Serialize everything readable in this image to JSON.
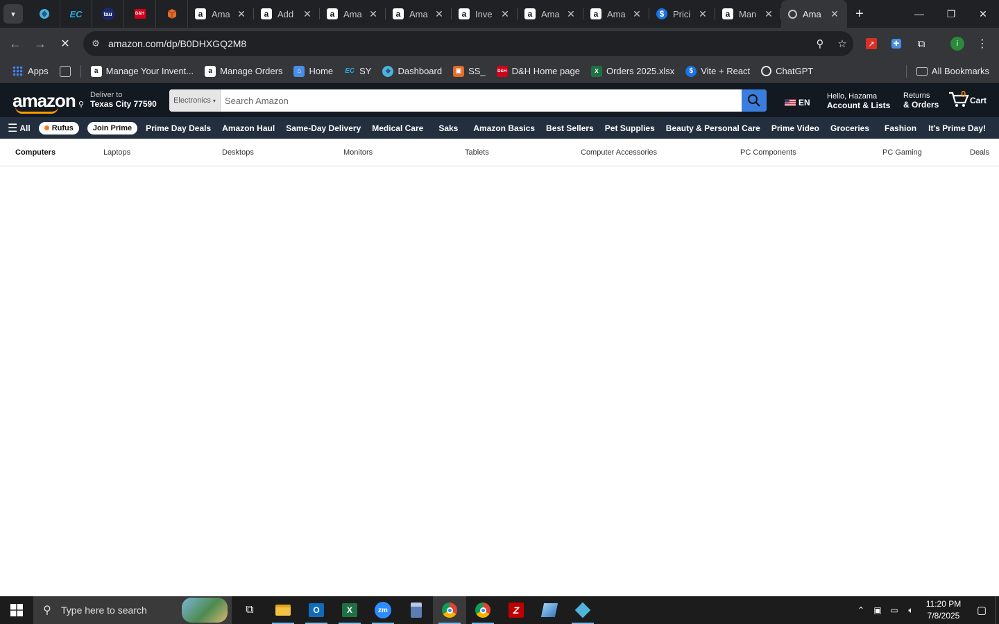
{
  "browser": {
    "tabs": [
      {
        "title": "Ama",
        "favicon": "amazon-icon"
      },
      {
        "title": "Add",
        "favicon": "amazon-icon"
      },
      {
        "title": "Ama",
        "favicon": "amazon-icon"
      },
      {
        "title": "Ama",
        "favicon": "amazon-icon"
      },
      {
        "title": "Inve",
        "favicon": "amazon-icon"
      },
      {
        "title": "Ama",
        "favicon": "amazon-icon"
      },
      {
        "title": "Ama",
        "favicon": "amazon-icon"
      },
      {
        "title": "Prici",
        "favicon": "dollar-icon"
      },
      {
        "title": "Man",
        "favicon": "amazon-icon"
      },
      {
        "title": "Ama",
        "favicon": "loading-icon",
        "active": true
      }
    ],
    "pinned_tabs": [
      {
        "label": "",
        "icon": "diamond-icon"
      },
      {
        "label": "EC",
        "icon": "ec-icon"
      },
      {
        "label": "tau",
        "icon": "tau-icon"
      },
      {
        "label": "D&H",
        "icon": "dh-icon"
      },
      {
        "label": "",
        "icon": "package-icon"
      }
    ],
    "url": "amazon.com/dp/B0DHXGQ2M8",
    "bookmarks": [
      {
        "label": "Apps",
        "icon": "apps-grid-icon"
      },
      {
        "label": "",
        "icon": "tab-groups-icon"
      },
      {
        "label": "Manage Your Invent...",
        "icon": "amazon-icon"
      },
      {
        "label": "Manage Orders",
        "icon": "amazon-icon"
      },
      {
        "label": "Home",
        "icon": "home-bookmark-icon"
      },
      {
        "label": "SY",
        "icon": "ec-icon"
      },
      {
        "label": "Dashboard",
        "icon": "diamond-icon"
      },
      {
        "label": "SS_",
        "icon": "package-icon"
      },
      {
        "label": "D&H Home page",
        "icon": "dh-icon"
      },
      {
        "label": "Orders 2025.xlsx",
        "icon": "excel-icon"
      },
      {
        "label": "Vite + React",
        "icon": "dollar-icon"
      },
      {
        "label": "ChatGPT",
        "icon": "chatgpt-icon"
      }
    ],
    "all_bookmarks": "All Bookmarks"
  },
  "amazon": {
    "logo": "amazon",
    "deliver_to": "Deliver to",
    "location": "Texas City 77590",
    "search_category": "Electronics",
    "search_placeholder": "Search Amazon",
    "language": "EN",
    "greeting": "Hello, Hazama",
    "account": "Account & Lists",
    "returns": "Returns",
    "orders": "& Orders",
    "cart_count": "0",
    "cart": "Cart",
    "nav_all": "All",
    "rufus": "Rufus",
    "join_prime": "Join Prime",
    "nav_items": [
      "Prime Day Deals",
      "Amazon Haul",
      "Same-Day Delivery",
      "Medical Care",
      "Saks",
      "Amazon Basics",
      "Best Sellers",
      "Pet Supplies",
      "Beauty & Personal Care",
      "Prime Video",
      "Groceries",
      "Fashion"
    ],
    "prime_day": "It's Prime Day!",
    "subnav": [
      "Computers",
      "Laptops",
      "Desktops",
      "Monitors",
      "Tablets",
      "Computer Accessories",
      "PC Components",
      "PC Gaming",
      "Deals"
    ]
  },
  "taskbar": {
    "search_placeholder": "Type here to search",
    "time": "11:20 PM",
    "date": "7/8/2025"
  },
  "colors": {
    "amazon_dark": "#131921",
    "amazon_nav": "#232f3e",
    "amazon_orange": "#ff9900",
    "search_button": "#3b7ddd"
  }
}
